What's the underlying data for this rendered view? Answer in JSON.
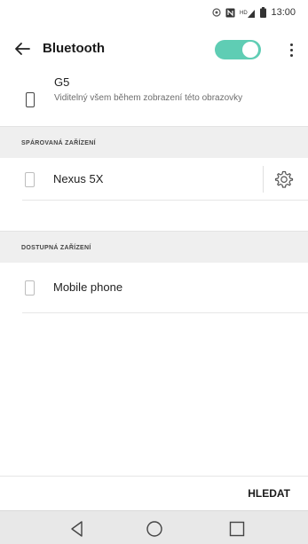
{
  "status_bar": {
    "time": "13:00",
    "icons": [
      "alarm-icon",
      "nfc-icon",
      "signal-icon",
      "battery-icon"
    ]
  },
  "header": {
    "back_icon": "arrow-left-icon",
    "title": "Bluetooth",
    "toggle_on": true,
    "toggle_color": "#5fcdb4",
    "more_icon": "vertical-dots-icon"
  },
  "own_device": {
    "name": "G5",
    "description": "Viditelný všem během zobrazení této obrazovky"
  },
  "paired_section": {
    "label": "SPÁROVANÁ ZAŘÍZENÍ",
    "devices": [
      {
        "name": "Nexus 5X",
        "icon": "phone-icon",
        "settings_icon": "gear-icon"
      }
    ]
  },
  "available_section": {
    "label": "DOSTUPNÁ ZAŘÍZENÍ",
    "devices": [
      {
        "name": "Mobile phone",
        "icon": "phone-icon"
      }
    ]
  },
  "footer": {
    "search_label": "HLEDAT"
  },
  "nav_bar": {
    "buttons": [
      "back-triangle-icon",
      "home-circle-icon",
      "recents-square-icon"
    ]
  }
}
